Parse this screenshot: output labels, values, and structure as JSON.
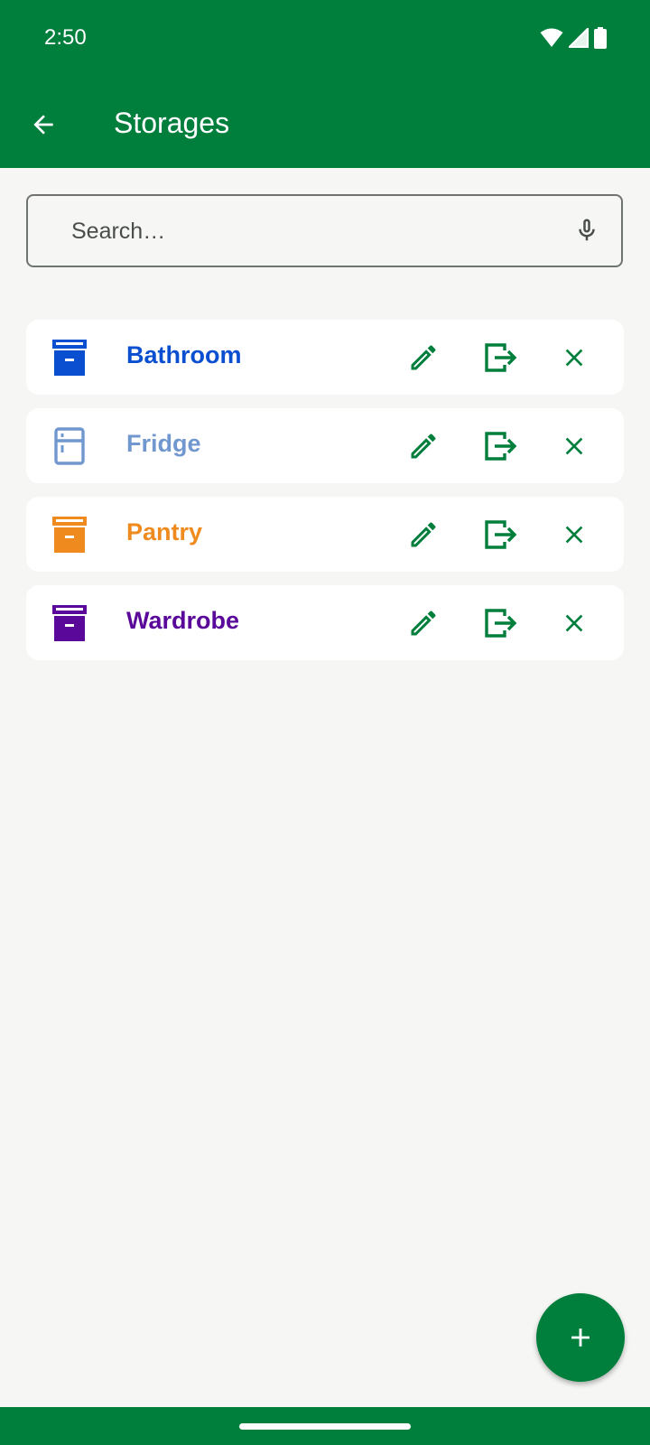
{
  "status_bar": {
    "time": "2:50"
  },
  "app_bar": {
    "title": "Storages"
  },
  "search": {
    "placeholder": "Search…",
    "value": ""
  },
  "storages": [
    {
      "name": "Bathroom",
      "icon": "archive-box-icon",
      "color": "#0b4fd1"
    },
    {
      "name": "Fridge",
      "icon": "fridge-icon",
      "color": "#7197cf"
    },
    {
      "name": "Pantry",
      "icon": "archive-box-icon",
      "color": "#ef8a1e"
    },
    {
      "name": "Wardrobe",
      "icon": "archive-box-icon",
      "color": "#5a089a"
    }
  ],
  "actions": {
    "edit": "pencil-icon",
    "move": "exit-arrow-icon",
    "delete": "close-icon"
  },
  "colors": {
    "primary": "#007e3c",
    "background": "#f6f7f5",
    "card": "#ffffff"
  }
}
